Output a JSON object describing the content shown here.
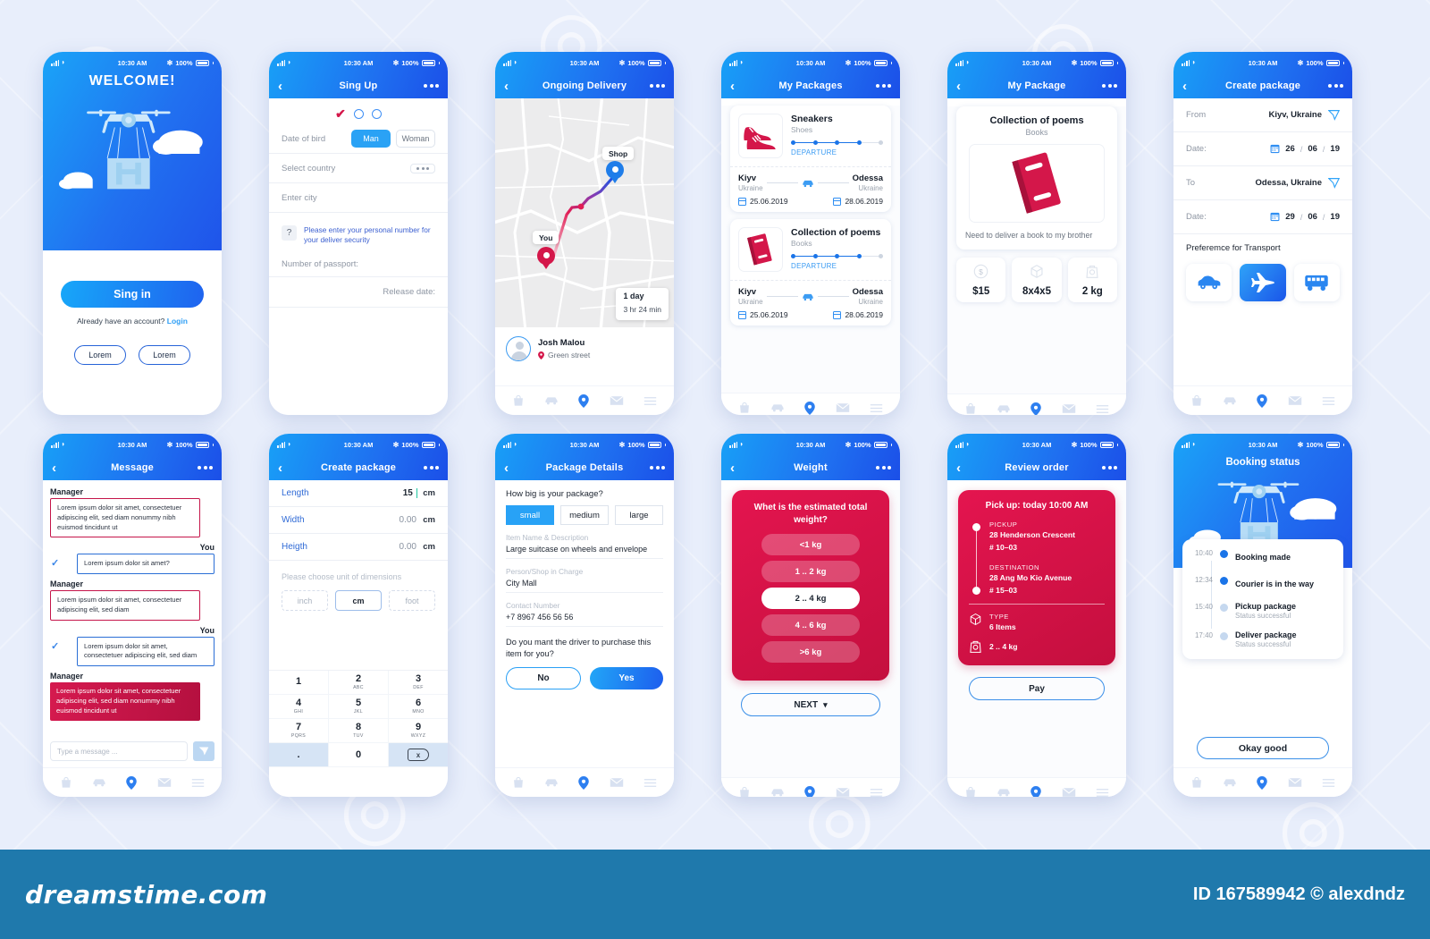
{
  "statusbar": {
    "time": "10:30 AM",
    "battery": "100%"
  },
  "tabbar": {
    "items": [
      "bag-icon",
      "car-icon",
      "location-pin-icon",
      "mail-icon",
      "menu-icon"
    ],
    "active_index": 2
  },
  "screens": {
    "welcome": {
      "title": "WELCOME!",
      "signin_label": "Sing in",
      "account_prompt": "Already have an account?",
      "login_label": "Login",
      "button1": "Lorem",
      "button2": "Lorem"
    },
    "signup": {
      "nav_title": "Sing Up",
      "date_of_birth_label": "Date of bird",
      "gender_man": "Man",
      "gender_woman": "Woman",
      "select_country": "Select country",
      "enter_city": "Enter city",
      "hint": "Please enter your personal number for your deliver security",
      "passport_label": "Number of passport:",
      "release_label": "Release date:"
    },
    "ongoing": {
      "nav_title": "Ongoing Delivery",
      "shop_label": "Shop",
      "you_label": "You",
      "eta_days": "1 day",
      "eta_time": "3 hr  24 min",
      "driver_name": "Josh Malou",
      "driver_street": "Green street"
    },
    "packages": {
      "nav_title": "My Packages",
      "items": [
        {
          "name": "Sneakers",
          "category": "Shoes",
          "status": "DEPARTURE",
          "from_city": "Kiyv",
          "from_country": "Ukraine",
          "from_date": "25.06.2019",
          "to_city": "Odessa",
          "to_country": "Ukraine",
          "to_date": "28.06.2019",
          "icon": "sneakers-icon"
        },
        {
          "name": "Collection of poems",
          "category": "Books",
          "status": "DEPARTURE",
          "from_city": "Kiyv",
          "from_country": "Ukraine",
          "from_date": "25.06.2019",
          "to_city": "Odessa",
          "to_country": "Ukraine",
          "to_date": "28.06.2019",
          "icon": "book-icon"
        }
      ]
    },
    "package": {
      "nav_title": "My Package",
      "title": "Collection of poems",
      "subtitle": "Books",
      "description": "Need to deliver a book to my brother",
      "stat_price": "$15",
      "stat_dims": "8x4x5",
      "stat_weight": "2 kg"
    },
    "create_route": {
      "nav_title": "Create package",
      "from_label": "From",
      "from_value": "Kiyv, Ukraine",
      "date1_label": "Date:",
      "date1_d": "26",
      "date1_m": "06",
      "date1_y": "19",
      "to_label": "To",
      "to_value": "Odessa, Ukraine",
      "date2_label": "Date:",
      "date2_d": "29",
      "date2_m": "06",
      "date2_y": "19",
      "transport_label": "Preferemce for Transport",
      "transports": [
        "car-icon",
        "plane-icon",
        "bus-icon"
      ],
      "transport_active": 1
    },
    "message": {
      "nav_title": "Message",
      "manager_label": "Manager",
      "you_label": "You",
      "bubbles": [
        {
          "who": "Manager",
          "text": "Lorem ipsum dolor sit amet, consectetuer adipiscing elit, sed diam nonummy nibh euismod tincidunt ut"
        },
        {
          "who": "You",
          "text": "Lorem ipsum dolor sit amet?"
        },
        {
          "who": "Manager",
          "text": "Lorem ipsum dolor sit amet, consectetuer adipiscing elit, sed diam"
        },
        {
          "who": "You",
          "text": "Lorem ipsum dolor sit amet, consectetuer adipiscing elit, sed diam"
        },
        {
          "who": "Manager",
          "text": "Lorem ipsum dolor sit amet, consectetuer adipiscing elit, sed diam nonummy nibh euismod tincidunt ut"
        }
      ],
      "input_placeholder": "Type a message ..."
    },
    "dimensions": {
      "nav_title": "Create package",
      "length_label": "Length",
      "length_value": "15",
      "length_unit": "cm",
      "width_label": "Width",
      "width_value": "0.00",
      "width_unit": "cm",
      "height_label": "Heigth",
      "height_value": "0.00",
      "height_unit": "cm",
      "unit_prompt": "Please choose unit of dimensions",
      "units": [
        "inch",
        "cm",
        "foot"
      ],
      "unit_active": 1,
      "keys": [
        {
          "n": "1",
          "s": ""
        },
        {
          "n": "2",
          "s": "ABC"
        },
        {
          "n": "3",
          "s": "DEF"
        },
        {
          "n": "4",
          "s": "GHI"
        },
        {
          "n": "5",
          "s": "JKL"
        },
        {
          "n": "6",
          "s": "MNO"
        },
        {
          "n": "7",
          "s": "PQRS"
        },
        {
          "n": "8",
          "s": "TUV"
        },
        {
          "n": "9",
          "s": "WXYZ"
        },
        {
          "n": ".",
          "s": ""
        },
        {
          "n": "0",
          "s": ""
        },
        {
          "n": "x",
          "s": ""
        }
      ]
    },
    "details": {
      "nav_title": "Package Details",
      "question": "How big is your package?",
      "sizes": [
        "small",
        "medium",
        "large"
      ],
      "size_active": 0,
      "item_label": "Item Name & Description",
      "item_value": "Large suitcase on wheels and envelope",
      "person_label": "Person/Shop in Charge",
      "person_value": "City Mall",
      "contact_label": "Contact Number",
      "contact_value": "+7 8967 456 56 56",
      "purchase_question": "Do you mant the driver to purchase this item for you?",
      "no_label": "No",
      "yes_label": "Yes"
    },
    "weight": {
      "nav_title": "Weight",
      "question": "Whet is the estimated total weight?",
      "options": [
        "<1 kg",
        "1 .. 2 kg",
        "2 .. 4 kg",
        "4 .. 6 kg",
        ">6 kg"
      ],
      "option_active": 2,
      "next_label": "NEXT"
    },
    "review": {
      "nav_title": "Review order",
      "pickup_time": "Pick up: today 10:00 AM",
      "pickup_label": "PICKUP",
      "pickup_address": "28 Henderson Crescent",
      "pickup_unit": "# 10–03",
      "dest_label": "DESTINATION",
      "dest_address": "28 Ang Mo Kio Avenue",
      "dest_unit": "# 15–03",
      "type_label": "TYPE",
      "type_value": "6 Items",
      "weight_value": "2 .. 4 kg",
      "pay_label": "Pay"
    },
    "booking": {
      "nav_title": "Booking status",
      "timeline": [
        {
          "time": "10:40",
          "title": "Booking made",
          "sub": "",
          "done": true
        },
        {
          "time": "12:34",
          "title": "Courier is in the way",
          "sub": "",
          "done": true
        },
        {
          "time": "15:40",
          "title": "Pickup package",
          "sub": "Status successful",
          "done": false
        },
        {
          "time": "17:40",
          "title": "Deliver package",
          "sub": "Status successful",
          "done": false
        }
      ],
      "ok_label": "Okay good"
    }
  },
  "footer": {
    "logo": "dreamstime.com",
    "credit": "ID 167589942 © alexdndz"
  },
  "colors": {
    "blue": "#1f6ff0",
    "light_blue": "#18a0f7",
    "red": "#d4174a",
    "bg": "#e8eefb"
  }
}
